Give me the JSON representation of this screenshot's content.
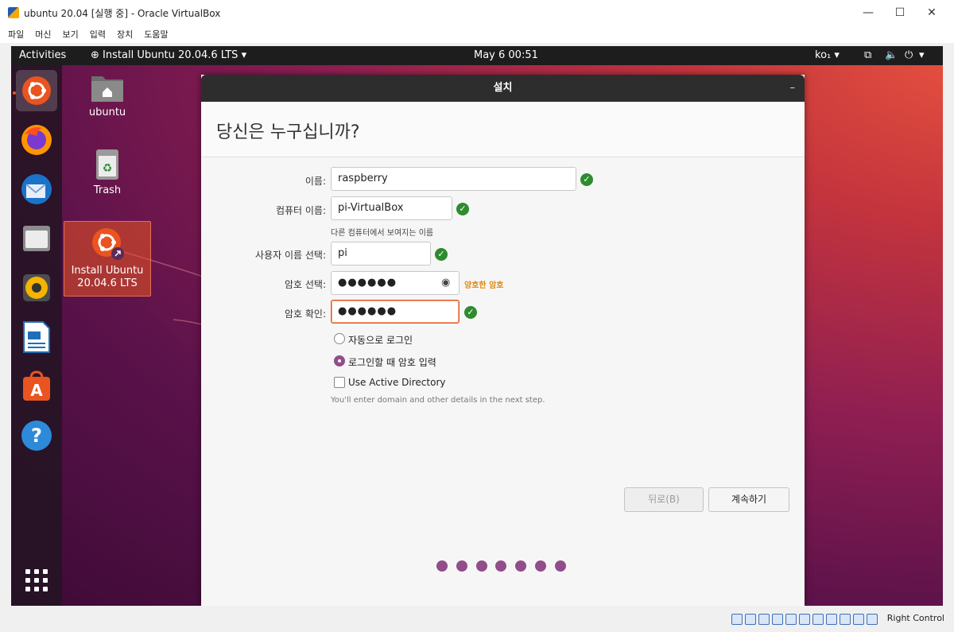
{
  "window": {
    "title": "ubuntu 20.04 [실행 중] - Oracle VirtualBox",
    "controls": {
      "minimize": "—",
      "maximize": "☐",
      "close": "✕"
    }
  },
  "menu": [
    "파일",
    "머신",
    "보기",
    "입력",
    "장치",
    "도움말"
  ],
  "topbar": {
    "activities": "Activities",
    "app": "Install Ubuntu 20.04.6 LTS",
    "datetime": "May 6  00:51",
    "lang": "ko₁"
  },
  "dock": {
    "icons": [
      "ubuntu-installer-icon",
      "firefox-icon",
      "thunderbird-icon",
      "files-icon",
      "rhythmbox-icon",
      "writer-icon",
      "software-icon",
      "help-icon",
      "show-apps-icon"
    ]
  },
  "desktop": {
    "icons": [
      {
        "label": "ubuntu"
      },
      {
        "label": "Trash"
      },
      {
        "label": "Install Ubuntu\n20.04.6 LTS"
      }
    ]
  },
  "dialog": {
    "title": "설치",
    "minimize": "–",
    "heading": "당신은 누구십니까?",
    "fields": {
      "name": {
        "label": "이름:",
        "value": "raspberry"
      },
      "computer": {
        "label": "컴퓨터 이름:",
        "value": "pi-VirtualBox",
        "hint": "다른 컴퓨터에서 보여지는 이름"
      },
      "username": {
        "label": "사용자 이름 선택:",
        "value": "pi"
      },
      "password": {
        "label": "암호 선택:",
        "value": "●●●●●●",
        "strength": "양호한 암호"
      },
      "confirm": {
        "label": "암호 확인:",
        "value": "●●●●●●"
      }
    },
    "options": {
      "auto_login": "자동으로 로그인",
      "require_password": "로그인할 때 암호 입력",
      "active_directory": "Use Active Directory",
      "ad_hint": "You'll enter domain and other details in the next step."
    },
    "buttons": {
      "back": "뒤로(B)",
      "continue": "계속하기"
    },
    "progress": {
      "total_dots": 7
    }
  },
  "statusbar": {
    "host_key": "Right Control"
  }
}
